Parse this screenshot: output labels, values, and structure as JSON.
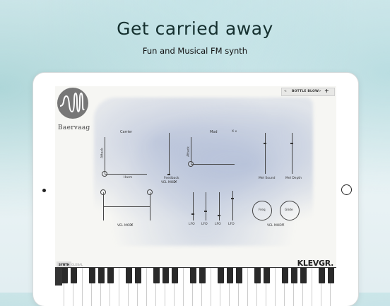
{
  "headline": "Get carried away",
  "subline": "Fun and Musical FM synth",
  "app": {
    "logo_text": "Baervaag",
    "preset": {
      "prev": "<",
      "name": "BOTTLE BLOW",
      "next": ">",
      "add": "+"
    },
    "sections": {
      "carrier": "Carrier",
      "mod": "Mod",
      "mod_ratio": "X x"
    },
    "labels": {
      "carrier_y": "Attack",
      "carrier_x": "Harm",
      "feedback": "Feedback",
      "vel_mod_1": "VEL MOD",
      "mod_y": "Attack",
      "mod_sound": "Mel Sound",
      "mod_depth": "Mel Depth",
      "vel_mod_2": "VEL MOD",
      "lfo1": "LFO",
      "lfo2": "LFO",
      "lfo3": "LFO",
      "lfo4": "LFO",
      "freq": "Freq",
      "glide": "Glide",
      "vel_mod_3": "VEL MOD"
    },
    "x_mark": "✕",
    "tabs": {
      "synth": "SYNTH",
      "global": "GLOBAL"
    },
    "brand": "KLEVGR."
  },
  "colors": {
    "ink": "#444444",
    "wash": "#a9b6d4"
  }
}
